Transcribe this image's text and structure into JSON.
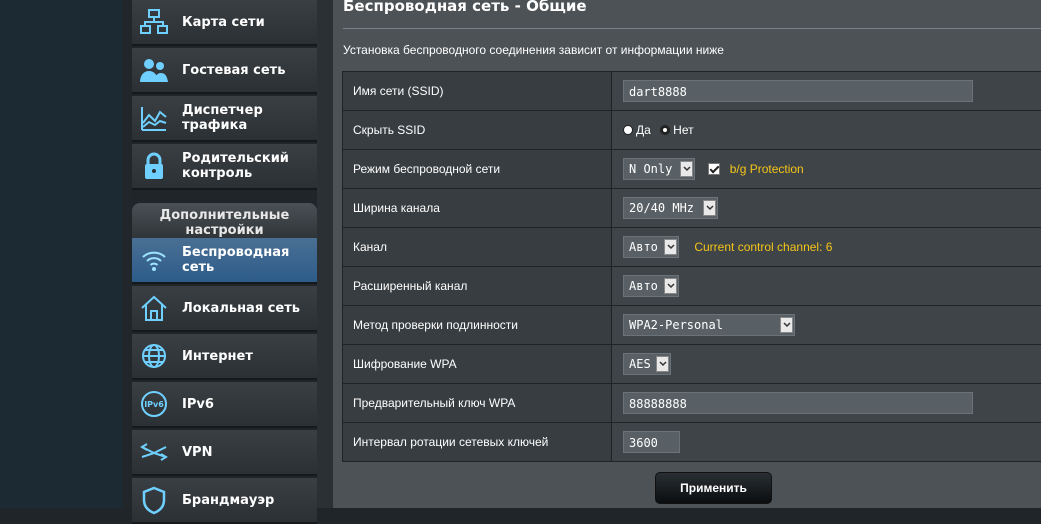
{
  "sidebar": {
    "items": [
      {
        "label": "Карта сети",
        "icon": "network-map-icon"
      },
      {
        "label": "Гостевая сеть",
        "icon": "guest-network-icon"
      },
      {
        "label": "Диспетчер трафика",
        "icon": "traffic-manager-icon"
      },
      {
        "label": "Родительский контроль",
        "icon": "parental-control-icon"
      }
    ],
    "advanced_header": "Дополнительные настройки",
    "advanced_items": [
      {
        "label": "Беспроводная сеть",
        "icon": "wireless-icon",
        "active": true
      },
      {
        "label": "Локальная сеть",
        "icon": "home-icon"
      },
      {
        "label": "Интернет",
        "icon": "globe-icon"
      },
      {
        "label": "IPv6",
        "icon": "ipv6-icon"
      },
      {
        "label": "VPN",
        "icon": "vpn-icon"
      },
      {
        "label": "Брандмауэр",
        "icon": "firewall-shield-icon"
      }
    ]
  },
  "page": {
    "title": "Беспроводная сеть - Общие",
    "description": "Установка беспроводного соединения зависит от информации ниже"
  },
  "form": {
    "ssid": {
      "label": "Имя сети (SSID)",
      "value": "dart8888"
    },
    "hide_ssid": {
      "label": "Скрыть SSID",
      "yes": "Да",
      "no": "Нет",
      "selected": "Нет"
    },
    "mode": {
      "label": "Режим беспроводной сети",
      "value": "N Only",
      "bg_protection": "b/g Protection",
      "bg_checked": true
    },
    "bandwidth": {
      "label": "Ширина канала",
      "value": "20/40 MHz"
    },
    "channel": {
      "label": "Канал",
      "value": "Авто",
      "note": "Current control channel: 6"
    },
    "ext_channel": {
      "label": "Расширенный канал",
      "value": "Авто"
    },
    "auth": {
      "label": "Метод проверки подлинности",
      "value": "WPA2-Personal"
    },
    "encryption": {
      "label": "Шифрование WPA",
      "value": "AES"
    },
    "psk": {
      "label": "Предварительный ключ WPA",
      "value": "88888888"
    },
    "rotation": {
      "label": "Интервал ротации сетевых ключей",
      "value": "3600"
    }
  },
  "apply_label": "Применить",
  "colors": {
    "accent_yellow": "#f5c518",
    "active_blue": "#2d5c8a"
  }
}
